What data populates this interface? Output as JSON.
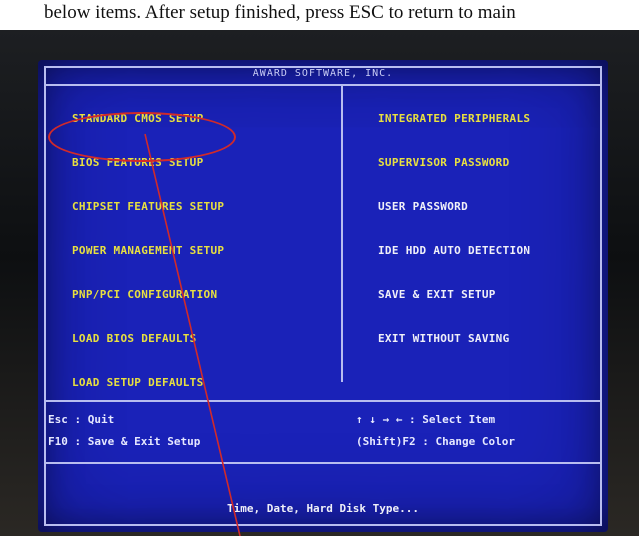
{
  "caption": "below items. After setup finished, press ESC to return to main",
  "bios": {
    "title": "AWARD SOFTWARE, INC.",
    "left_menu": [
      "STANDARD CMOS SETUP",
      "BIOS FEATURES SETUP",
      "CHIPSET FEATURES SETUP",
      "POWER MANAGEMENT SETUP",
      "PNP/PCI CONFIGURATION",
      "LOAD BIOS DEFAULTS",
      "LOAD SETUP DEFAULTS"
    ],
    "right_menu": [
      "INTEGRATED PERIPHERALS",
      "SUPERVISOR PASSWORD",
      "USER PASSWORD",
      "IDE HDD AUTO DETECTION",
      "SAVE & EXIT SETUP",
      "EXIT WITHOUT SAVING"
    ],
    "help": {
      "esc": "Esc : Quit",
      "f10": "F10 : Save & Exit Setup",
      "arrows": "↑ ↓ → ←  : Select Item",
      "shift_f2": "(Shift)F2 : Change Color"
    },
    "description": "Time, Date, Hard Disk Type..."
  },
  "colors": {
    "screen_bg": "#1a22b8",
    "menu_text": "#e8e040",
    "annotation": "#d12a2a"
  }
}
